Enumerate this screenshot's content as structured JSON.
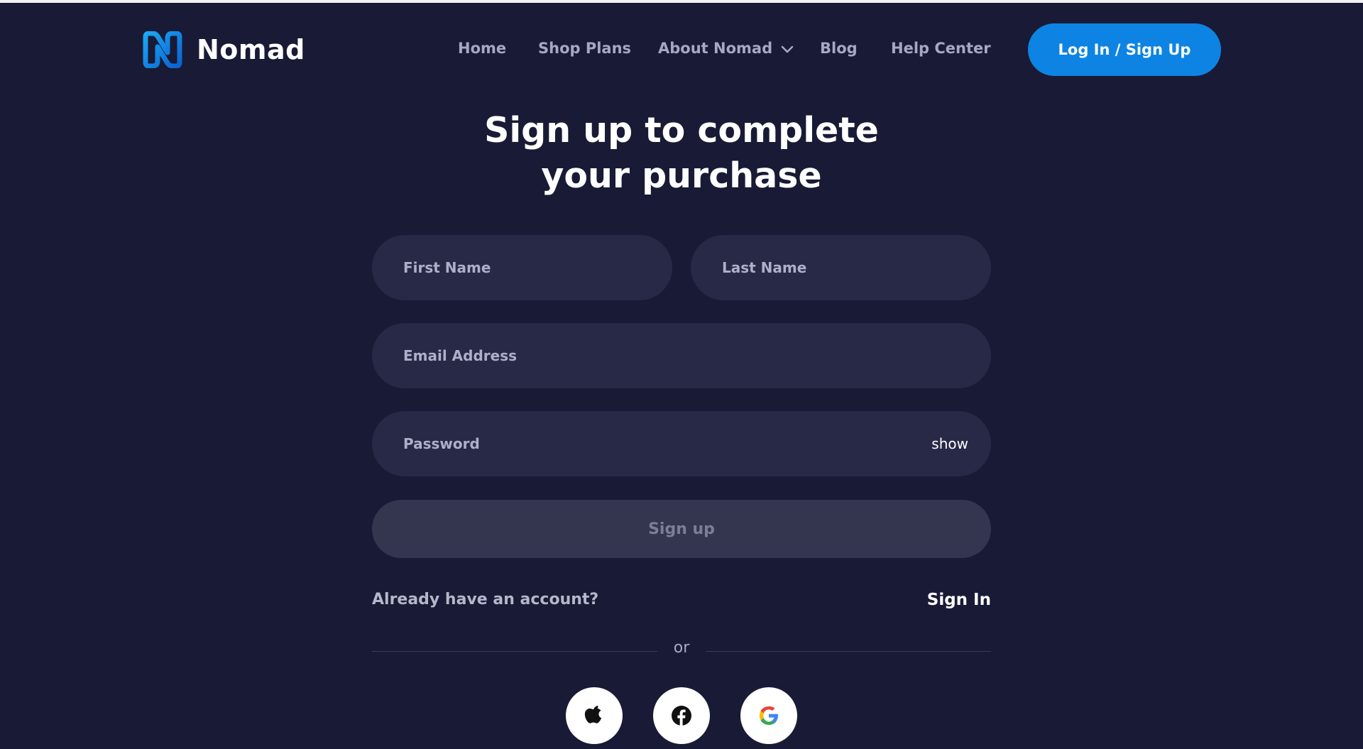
{
  "brand": {
    "name": "Nomad",
    "accent": "#0d84e3",
    "logo_colors": [
      "#1a9df0",
      "#0b6fd6"
    ]
  },
  "nav": {
    "items": [
      {
        "label": "Home"
      },
      {
        "label": "Shop Plans"
      },
      {
        "label": "About Nomad",
        "icon": "chevron-down-icon"
      },
      {
        "label": "Blog"
      },
      {
        "label": "Help Center"
      }
    ],
    "cta_label": "Log In / Sign Up"
  },
  "form": {
    "heading_line1": "Sign up to complete",
    "heading_line2": "your purchase",
    "first_name_placeholder": "First Name",
    "last_name_placeholder": "Last Name",
    "email_placeholder": "Email Address",
    "password_placeholder": "Password",
    "show_label": "show",
    "submit_label": "Sign up",
    "already_text": "Already have an account?",
    "signin_label": "Sign In",
    "or_text": "or"
  },
  "social": [
    {
      "name": "apple-icon"
    },
    {
      "name": "facebook-icon"
    },
    {
      "name": "google-icon"
    }
  ],
  "colors": {
    "background": "#191a35",
    "field": "#282947",
    "submit_disabled": "#34354f"
  }
}
